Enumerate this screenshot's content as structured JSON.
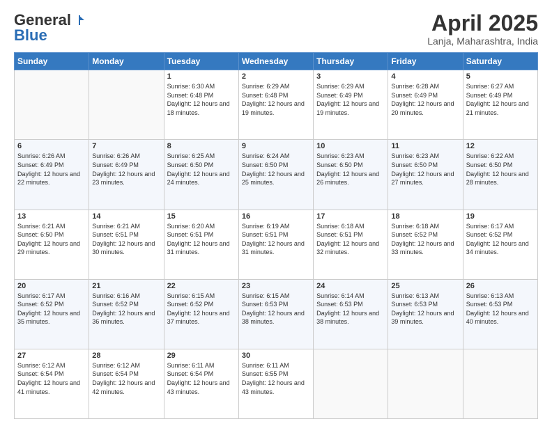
{
  "header": {
    "logo_general": "General",
    "logo_blue": "Blue",
    "title": "April 2025",
    "location": "Lanja, Maharashtra, India"
  },
  "weekdays": [
    "Sunday",
    "Monday",
    "Tuesday",
    "Wednesday",
    "Thursday",
    "Friday",
    "Saturday"
  ],
  "weeks": [
    [
      {
        "day": "",
        "sunrise": "",
        "sunset": "",
        "daylight": ""
      },
      {
        "day": "",
        "sunrise": "",
        "sunset": "",
        "daylight": ""
      },
      {
        "day": "1",
        "sunrise": "Sunrise: 6:30 AM",
        "sunset": "Sunset: 6:48 PM",
        "daylight": "Daylight: 12 hours and 18 minutes."
      },
      {
        "day": "2",
        "sunrise": "Sunrise: 6:29 AM",
        "sunset": "Sunset: 6:48 PM",
        "daylight": "Daylight: 12 hours and 19 minutes."
      },
      {
        "day": "3",
        "sunrise": "Sunrise: 6:29 AM",
        "sunset": "Sunset: 6:49 PM",
        "daylight": "Daylight: 12 hours and 19 minutes."
      },
      {
        "day": "4",
        "sunrise": "Sunrise: 6:28 AM",
        "sunset": "Sunset: 6:49 PM",
        "daylight": "Daylight: 12 hours and 20 minutes."
      },
      {
        "day": "5",
        "sunrise": "Sunrise: 6:27 AM",
        "sunset": "Sunset: 6:49 PM",
        "daylight": "Daylight: 12 hours and 21 minutes."
      }
    ],
    [
      {
        "day": "6",
        "sunrise": "Sunrise: 6:26 AM",
        "sunset": "Sunset: 6:49 PM",
        "daylight": "Daylight: 12 hours and 22 minutes."
      },
      {
        "day": "7",
        "sunrise": "Sunrise: 6:26 AM",
        "sunset": "Sunset: 6:49 PM",
        "daylight": "Daylight: 12 hours and 23 minutes."
      },
      {
        "day": "8",
        "sunrise": "Sunrise: 6:25 AM",
        "sunset": "Sunset: 6:50 PM",
        "daylight": "Daylight: 12 hours and 24 minutes."
      },
      {
        "day": "9",
        "sunrise": "Sunrise: 6:24 AM",
        "sunset": "Sunset: 6:50 PM",
        "daylight": "Daylight: 12 hours and 25 minutes."
      },
      {
        "day": "10",
        "sunrise": "Sunrise: 6:23 AM",
        "sunset": "Sunset: 6:50 PM",
        "daylight": "Daylight: 12 hours and 26 minutes."
      },
      {
        "day": "11",
        "sunrise": "Sunrise: 6:23 AM",
        "sunset": "Sunset: 6:50 PM",
        "daylight": "Daylight: 12 hours and 27 minutes."
      },
      {
        "day": "12",
        "sunrise": "Sunrise: 6:22 AM",
        "sunset": "Sunset: 6:50 PM",
        "daylight": "Daylight: 12 hours and 28 minutes."
      }
    ],
    [
      {
        "day": "13",
        "sunrise": "Sunrise: 6:21 AM",
        "sunset": "Sunset: 6:50 PM",
        "daylight": "Daylight: 12 hours and 29 minutes."
      },
      {
        "day": "14",
        "sunrise": "Sunrise: 6:21 AM",
        "sunset": "Sunset: 6:51 PM",
        "daylight": "Daylight: 12 hours and 30 minutes."
      },
      {
        "day": "15",
        "sunrise": "Sunrise: 6:20 AM",
        "sunset": "Sunset: 6:51 PM",
        "daylight": "Daylight: 12 hours and 31 minutes."
      },
      {
        "day": "16",
        "sunrise": "Sunrise: 6:19 AM",
        "sunset": "Sunset: 6:51 PM",
        "daylight": "Daylight: 12 hours and 31 minutes."
      },
      {
        "day": "17",
        "sunrise": "Sunrise: 6:18 AM",
        "sunset": "Sunset: 6:51 PM",
        "daylight": "Daylight: 12 hours and 32 minutes."
      },
      {
        "day": "18",
        "sunrise": "Sunrise: 6:18 AM",
        "sunset": "Sunset: 6:52 PM",
        "daylight": "Daylight: 12 hours and 33 minutes."
      },
      {
        "day": "19",
        "sunrise": "Sunrise: 6:17 AM",
        "sunset": "Sunset: 6:52 PM",
        "daylight": "Daylight: 12 hours and 34 minutes."
      }
    ],
    [
      {
        "day": "20",
        "sunrise": "Sunrise: 6:17 AM",
        "sunset": "Sunset: 6:52 PM",
        "daylight": "Daylight: 12 hours and 35 minutes."
      },
      {
        "day": "21",
        "sunrise": "Sunrise: 6:16 AM",
        "sunset": "Sunset: 6:52 PM",
        "daylight": "Daylight: 12 hours and 36 minutes."
      },
      {
        "day": "22",
        "sunrise": "Sunrise: 6:15 AM",
        "sunset": "Sunset: 6:52 PM",
        "daylight": "Daylight: 12 hours and 37 minutes."
      },
      {
        "day": "23",
        "sunrise": "Sunrise: 6:15 AM",
        "sunset": "Sunset: 6:53 PM",
        "daylight": "Daylight: 12 hours and 38 minutes."
      },
      {
        "day": "24",
        "sunrise": "Sunrise: 6:14 AM",
        "sunset": "Sunset: 6:53 PM",
        "daylight": "Daylight: 12 hours and 38 minutes."
      },
      {
        "day": "25",
        "sunrise": "Sunrise: 6:13 AM",
        "sunset": "Sunset: 6:53 PM",
        "daylight": "Daylight: 12 hours and 39 minutes."
      },
      {
        "day": "26",
        "sunrise": "Sunrise: 6:13 AM",
        "sunset": "Sunset: 6:53 PM",
        "daylight": "Daylight: 12 hours and 40 minutes."
      }
    ],
    [
      {
        "day": "27",
        "sunrise": "Sunrise: 6:12 AM",
        "sunset": "Sunset: 6:54 PM",
        "daylight": "Daylight: 12 hours and 41 minutes."
      },
      {
        "day": "28",
        "sunrise": "Sunrise: 6:12 AM",
        "sunset": "Sunset: 6:54 PM",
        "daylight": "Daylight: 12 hours and 42 minutes."
      },
      {
        "day": "29",
        "sunrise": "Sunrise: 6:11 AM",
        "sunset": "Sunset: 6:54 PM",
        "daylight": "Daylight: 12 hours and 43 minutes."
      },
      {
        "day": "30",
        "sunrise": "Sunrise: 6:11 AM",
        "sunset": "Sunset: 6:55 PM",
        "daylight": "Daylight: 12 hours and 43 minutes."
      },
      {
        "day": "",
        "sunrise": "",
        "sunset": "",
        "daylight": ""
      },
      {
        "day": "",
        "sunrise": "",
        "sunset": "",
        "daylight": ""
      },
      {
        "day": "",
        "sunrise": "",
        "sunset": "",
        "daylight": ""
      }
    ]
  ]
}
